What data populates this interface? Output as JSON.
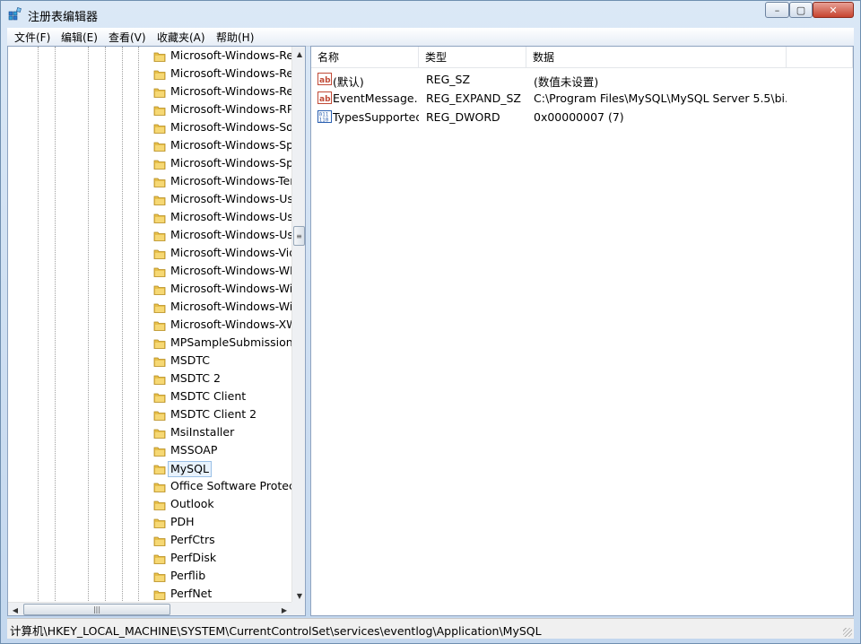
{
  "window": {
    "title": "注册表编辑器",
    "controls": {
      "minimize": "–",
      "maximize": "▢",
      "close": "✕"
    }
  },
  "menu": [
    "文件(F)",
    "编辑(E)",
    "查看(V)",
    "收藏夹(A)",
    "帮助(H)"
  ],
  "tree": {
    "items": [
      "Microsoft-Windows-Rem",
      "Microsoft-Windows-Rem",
      "Microsoft-Windows-Res",
      "Microsoft-Windows-RPC",
      "Microsoft-Windows-Sof",
      "Microsoft-Windows-Spe",
      "Microsoft-Windows-Spe",
      "Microsoft-Windows-Ter",
      "Microsoft-Windows-Use",
      "Microsoft-Windows-Use",
      "Microsoft-Windows-Use",
      "Microsoft-Windows-Vid",
      "Microsoft-Windows-WE",
      "Microsoft-Windows-Win",
      "Microsoft-Windows-Win",
      "Microsoft-Windows-XW",
      "MPSampleSubmission",
      "MSDTC",
      "MSDTC 2",
      "MSDTC Client",
      "MSDTC Client 2",
      "MsiInstaller",
      "MSSOAP",
      "MySQL",
      "Office Software Protecti",
      "Outlook",
      "PDH",
      "PerfCtrs",
      "PerfDisk",
      "Perflib",
      "PerfNet"
    ],
    "selected_index": 23,
    "scroll": {
      "up": "▲",
      "down": "▼",
      "left": "◀",
      "right": "▶",
      "thumb_grip": "≡",
      "hthumb_grip": "|||"
    }
  },
  "values": {
    "columns": [
      "名称",
      "类型",
      "数据"
    ],
    "rows": [
      {
        "icon": "string-value-icon",
        "name": "(默认)",
        "type": "REG_SZ",
        "data": "(数值未设置)"
      },
      {
        "icon": "string-value-icon",
        "name": "EventMessage...",
        "type": "REG_EXPAND_SZ",
        "data": "C:\\Program Files\\MySQL\\MySQL Server 5.5\\bi..."
      },
      {
        "icon": "binary-value-icon",
        "name": "TypesSupported",
        "type": "REG_DWORD",
        "data": "0x00000007 (7)"
      }
    ]
  },
  "status": {
    "path": "计算机\\HKEY_LOCAL_MACHINE\\SYSTEM\\CurrentControlSet\\services\\eventlog\\Application\\MySQL"
  }
}
